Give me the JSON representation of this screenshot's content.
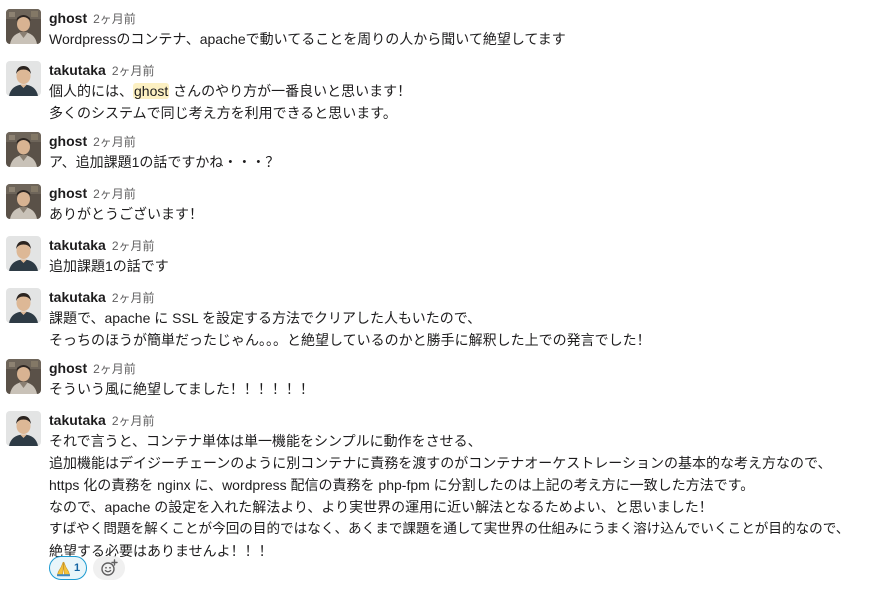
{
  "messages": [
    {
      "author": "ghost",
      "time": "2ヶ月前",
      "avatar": "ghost-avatar",
      "lines": [
        "Wordpressのコンテナ、apacheで動いてることを周りの人から聞いて絶望してます"
      ]
    },
    {
      "author": "takutaka",
      "time": "2ヶ月前",
      "avatar": "takutaka-avatar",
      "line1_before": "個人的には、",
      "line1_mention": "ghost",
      "line1_after": " さんのやり方が一番良いと思います！",
      "lines": [
        "多くのシステムで同じ考え方を利用できると思います。"
      ]
    },
    {
      "author": "ghost",
      "time": "2ヶ月前",
      "avatar": "ghost-avatar",
      "lines": [
        "ア、追加課題1の話ですかね・・・？"
      ]
    },
    {
      "author": "ghost",
      "time": "2ヶ月前",
      "avatar": "ghost-avatar",
      "lines": [
        "ありがとうございます！"
      ]
    },
    {
      "author": "takutaka",
      "time": "2ヶ月前",
      "avatar": "takutaka-avatar",
      "lines": [
        "追加課題1の話です"
      ]
    },
    {
      "author": "takutaka",
      "time": "2ヶ月前",
      "avatar": "takutaka-avatar",
      "lines": [
        "課題で、apache に SSL を設定する方法でクリアした人もいたので、",
        "そっちのほうが簡単だったじゃん。。。と絶望しているのかと勝手に解釈した上での発言でした！"
      ]
    },
    {
      "author": "ghost",
      "time": "2ヶ月前",
      "avatar": "ghost-avatar",
      "lines": [
        "そういう風に絶望してました！！！！！！"
      ]
    },
    {
      "author": "takutaka",
      "time": "2ヶ月前",
      "avatar": "takutaka-avatar",
      "lines": [
        "それで言うと、コンテナ単体は単一機能をシンプルに動作をさせる、",
        "追加機能はデイジーチェーンのように別コンテナに責務を渡すのがコンテナオーケストレーションの基本的な考え方なので、",
        "https 化の責務を nginx に、wordpress 配信の責務を php-fpm に分割したのは上記の考え方に一致した方法です。",
        "なので、apache の設定を入れた解法より、より実世界の運用に近い解法となるためよい、と思いました！",
        "すばやく問題を解くことが今回の目的ではなく、あくまで課題を通して実世界の仕組みにうまく溶け込んでいくことが目的なので、",
        "絶望する必要はありませんよ！！！"
      ]
    }
  ],
  "reactions": [
    {
      "emoji": "folded-hands-emoji",
      "count": "1"
    }
  ],
  "add_reaction_icon": "add-reaction-icon",
  "colors": {
    "mention_bg": "#fcf0c2",
    "reaction_bg": "#e8f5fa",
    "reaction_border": "#1d9bd1",
    "reaction_count": "#1264a3",
    "timestamp": "#616061",
    "text": "#1d1c1d"
  }
}
